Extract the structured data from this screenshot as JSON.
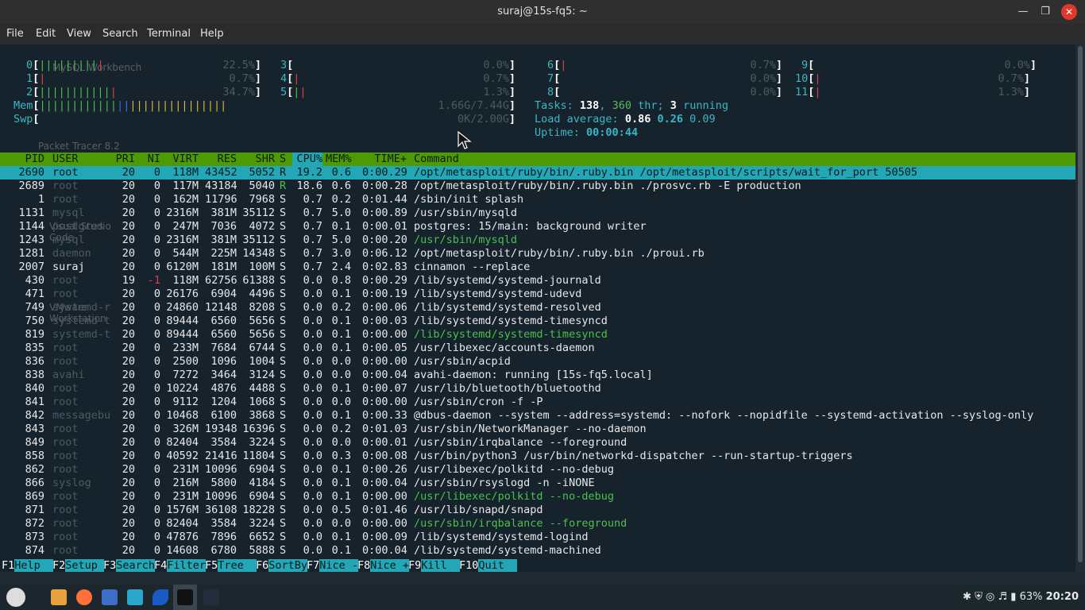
{
  "window": {
    "title": "suraj@15s-fq5: ~"
  },
  "menu": [
    "File",
    "Edit",
    "View",
    "Search",
    "Terminal",
    "Help"
  ],
  "desktop": {
    "icons": [
      "MySQL Workbench",
      "Packet Tracer 8.2",
      "Visual Studio Code",
      "VMware Workstation"
    ]
  },
  "meters": {
    "cpus": [
      {
        "id": "0",
        "pct": "22.5%"
      },
      {
        "id": "1",
        "pct": "0.7%"
      },
      {
        "id": "2",
        "pct": "34.7%"
      },
      {
        "id": "3",
        "pct": "0.0%"
      },
      {
        "id": "4",
        "pct": "0.7%"
      },
      {
        "id": "5",
        "pct": "1.3%"
      },
      {
        "id": "6",
        "pct": "0.7%"
      },
      {
        "id": "7",
        "pct": "0.0%"
      },
      {
        "id": "8",
        "pct": "0.0%"
      },
      {
        "id": "9",
        "pct": "0.0%"
      },
      {
        "id": "10",
        "pct": "0.7%"
      },
      {
        "id": "11",
        "pct": "1.3%"
      }
    ],
    "mem": {
      "label": "Mem",
      "value": "1.66G/7.44G"
    },
    "swp": {
      "label": "Swp",
      "value": "0K/2.00G"
    }
  },
  "summary": {
    "tasks_label": "Tasks:",
    "tasks": "138",
    "thr": "360",
    "thr_label": "thr;",
    "running": "3",
    "running_label": "running",
    "load_label": "Load average:",
    "load1": "0.86",
    "load5": "0.26",
    "load15": "0.09",
    "uptime_label": "Uptime:",
    "uptime": "00:00:44"
  },
  "columns": [
    "PID",
    "USER",
    "PRI",
    "NI",
    "VIRT",
    "RES",
    "SHR",
    "S",
    "CPU%",
    "MEM%",
    "TIME+",
    "Command"
  ],
  "processes": [
    {
      "pid": "2690",
      "user": "root",
      "pri": "20",
      "ni": "0",
      "virt": "118M",
      "res": "43452",
      "shr": "5052",
      "s": "R",
      "cpu": "19.2",
      "mem": "0.6",
      "time": "0:00.29",
      "cmd": "/opt/metasploit/ruby/bin/.ruby.bin /opt/metasploit/scripts/wait_for_port 50505"
    },
    {
      "pid": "2689",
      "user": "root",
      "pri": "20",
      "ni": "0",
      "virt": "117M",
      "res": "43184",
      "shr": "5040",
      "s": "R",
      "cpu": "18.6",
      "mem": "0.6",
      "time": "0:00.28",
      "cmd": "/opt/metasploit/ruby/bin/.ruby.bin ./prosvc.rb -E production"
    },
    {
      "pid": "1",
      "user": "root",
      "pri": "20",
      "ni": "0",
      "virt": "162M",
      "res": "11796",
      "shr": "7968",
      "s": "S",
      "cpu": "0.7",
      "mem": "0.2",
      "time": "0:01.44",
      "cmd": "/sbin/init splash"
    },
    {
      "pid": "1131",
      "user": "mysql",
      "pri": "20",
      "ni": "0",
      "virt": "2316M",
      "res": "381M",
      "shr": "35112",
      "s": "S",
      "cpu": "0.7",
      "mem": "5.0",
      "time": "0:00.89",
      "cmd": "/usr/sbin/mysqld"
    },
    {
      "pid": "1144",
      "user": "postgres",
      "pri": "20",
      "ni": "0",
      "virt": "247M",
      "res": "7036",
      "shr": "4072",
      "s": "S",
      "cpu": "0.7",
      "mem": "0.1",
      "time": "0:00.01",
      "cmd": "postgres: 15/main: background writer"
    },
    {
      "pid": "1243",
      "user": "mysql",
      "pri": "20",
      "ni": "0",
      "virt": "2316M",
      "res": "381M",
      "shr": "35112",
      "s": "S",
      "cpu": "0.7",
      "mem": "5.0",
      "time": "0:00.20",
      "cmd": "/usr/sbin/mysqld",
      "thread": true
    },
    {
      "pid": "1281",
      "user": "daemon",
      "pri": "20",
      "ni": "0",
      "virt": "544M",
      "res": "225M",
      "shr": "14348",
      "s": "S",
      "cpu": "0.7",
      "mem": "3.0",
      "time": "0:06.12",
      "cmd": "/opt/metasploit/ruby/bin/.ruby.bin ./proui.rb"
    },
    {
      "pid": "2007",
      "user": "suraj",
      "pri": "20",
      "ni": "0",
      "virt": "6120M",
      "res": "181M",
      "shr": "100M",
      "s": "S",
      "cpu": "0.7",
      "mem": "2.4",
      "time": "0:02.83",
      "cmd": "cinnamon --replace"
    },
    {
      "pid": "430",
      "user": "root",
      "pri": "19",
      "ni": "-1",
      "virt": "118M",
      "res": "62756",
      "shr": "61388",
      "s": "S",
      "cpu": "0.0",
      "mem": "0.8",
      "time": "0:00.29",
      "cmd": "/lib/systemd/systemd-journald"
    },
    {
      "pid": "471",
      "user": "root",
      "pri": "20",
      "ni": "0",
      "virt": "26176",
      "res": "6904",
      "shr": "4496",
      "s": "S",
      "cpu": "0.0",
      "mem": "0.1",
      "time": "0:00.19",
      "cmd": "/lib/systemd/systemd-udevd"
    },
    {
      "pid": "749",
      "user": "systemd-r",
      "pri": "20",
      "ni": "0",
      "virt": "24860",
      "res": "12148",
      "shr": "8208",
      "s": "S",
      "cpu": "0.0",
      "mem": "0.2",
      "time": "0:00.06",
      "cmd": "/lib/systemd/systemd-resolved"
    },
    {
      "pid": "750",
      "user": "systemd-t",
      "pri": "20",
      "ni": "0",
      "virt": "89444",
      "res": "6560",
      "shr": "5656",
      "s": "S",
      "cpu": "0.0",
      "mem": "0.1",
      "time": "0:00.03",
      "cmd": "/lib/systemd/systemd-timesyncd"
    },
    {
      "pid": "819",
      "user": "systemd-t",
      "pri": "20",
      "ni": "0",
      "virt": "89444",
      "res": "6560",
      "shr": "5656",
      "s": "S",
      "cpu": "0.0",
      "mem": "0.1",
      "time": "0:00.00",
      "cmd": "/lib/systemd/systemd-timesyncd",
      "thread": true
    },
    {
      "pid": "835",
      "user": "root",
      "pri": "20",
      "ni": "0",
      "virt": "233M",
      "res": "7684",
      "shr": "6744",
      "s": "S",
      "cpu": "0.0",
      "mem": "0.1",
      "time": "0:00.05",
      "cmd": "/usr/libexec/accounts-daemon"
    },
    {
      "pid": "836",
      "user": "root",
      "pri": "20",
      "ni": "0",
      "virt": "2500",
      "res": "1096",
      "shr": "1004",
      "s": "S",
      "cpu": "0.0",
      "mem": "0.0",
      "time": "0:00.00",
      "cmd": "/usr/sbin/acpid"
    },
    {
      "pid": "838",
      "user": "avahi",
      "pri": "20",
      "ni": "0",
      "virt": "7272",
      "res": "3464",
      "shr": "3124",
      "s": "S",
      "cpu": "0.0",
      "mem": "0.0",
      "time": "0:00.04",
      "cmd": "avahi-daemon: running [15s-fq5.local]"
    },
    {
      "pid": "840",
      "user": "root",
      "pri": "20",
      "ni": "0",
      "virt": "10224",
      "res": "4876",
      "shr": "4488",
      "s": "S",
      "cpu": "0.0",
      "mem": "0.1",
      "time": "0:00.07",
      "cmd": "/usr/lib/bluetooth/bluetoothd"
    },
    {
      "pid": "841",
      "user": "root",
      "pri": "20",
      "ni": "0",
      "virt": "9112",
      "res": "1204",
      "shr": "1068",
      "s": "S",
      "cpu": "0.0",
      "mem": "0.0",
      "time": "0:00.00",
      "cmd": "/usr/sbin/cron -f -P"
    },
    {
      "pid": "842",
      "user": "messagebu",
      "pri": "20",
      "ni": "0",
      "virt": "10468",
      "res": "6100",
      "shr": "3868",
      "s": "S",
      "cpu": "0.0",
      "mem": "0.1",
      "time": "0:00.33",
      "cmd": "@dbus-daemon --system --address=systemd: --nofork --nopidfile --systemd-activation --syslog-only"
    },
    {
      "pid": "843",
      "user": "root",
      "pri": "20",
      "ni": "0",
      "virt": "326M",
      "res": "19348",
      "shr": "16396",
      "s": "S",
      "cpu": "0.0",
      "mem": "0.2",
      "time": "0:01.03",
      "cmd": "/usr/sbin/NetworkManager --no-daemon"
    },
    {
      "pid": "849",
      "user": "root",
      "pri": "20",
      "ni": "0",
      "virt": "82404",
      "res": "3584",
      "shr": "3224",
      "s": "S",
      "cpu": "0.0",
      "mem": "0.0",
      "time": "0:00.01",
      "cmd": "/usr/sbin/irqbalance --foreground"
    },
    {
      "pid": "858",
      "user": "root",
      "pri": "20",
      "ni": "0",
      "virt": "40592",
      "res": "21416",
      "shr": "11804",
      "s": "S",
      "cpu": "0.0",
      "mem": "0.3",
      "time": "0:00.08",
      "cmd": "/usr/bin/python3 /usr/bin/networkd-dispatcher --run-startup-triggers"
    },
    {
      "pid": "862",
      "user": "root",
      "pri": "20",
      "ni": "0",
      "virt": "231M",
      "res": "10096",
      "shr": "6904",
      "s": "S",
      "cpu": "0.0",
      "mem": "0.1",
      "time": "0:00.26",
      "cmd": "/usr/libexec/polkitd --no-debug"
    },
    {
      "pid": "866",
      "user": "syslog",
      "pri": "20",
      "ni": "0",
      "virt": "216M",
      "res": "5800",
      "shr": "4184",
      "s": "S",
      "cpu": "0.0",
      "mem": "0.1",
      "time": "0:00.04",
      "cmd": "/usr/sbin/rsyslogd -n -iNONE"
    },
    {
      "pid": "869",
      "user": "root",
      "pri": "20",
      "ni": "0",
      "virt": "231M",
      "res": "10096",
      "shr": "6904",
      "s": "S",
      "cpu": "0.0",
      "mem": "0.1",
      "time": "0:00.00",
      "cmd": "/usr/libexec/polkitd --no-debug",
      "thread": true
    },
    {
      "pid": "871",
      "user": "root",
      "pri": "20",
      "ni": "0",
      "virt": "1576M",
      "res": "36108",
      "shr": "18228",
      "s": "S",
      "cpu": "0.0",
      "mem": "0.5",
      "time": "0:01.46",
      "cmd": "/usr/lib/snapd/snapd"
    },
    {
      "pid": "872",
      "user": "root",
      "pri": "20",
      "ni": "0",
      "virt": "82404",
      "res": "3584",
      "shr": "3224",
      "s": "S",
      "cpu": "0.0",
      "mem": "0.0",
      "time": "0:00.00",
      "cmd": "/usr/sbin/irqbalance --foreground",
      "thread": true
    },
    {
      "pid": "873",
      "user": "root",
      "pri": "20",
      "ni": "0",
      "virt": "47876",
      "res": "7896",
      "shr": "6652",
      "s": "S",
      "cpu": "0.0",
      "mem": "0.1",
      "time": "0:00.09",
      "cmd": "/lib/systemd/systemd-logind"
    },
    {
      "pid": "874",
      "user": "root",
      "pri": "20",
      "ni": "0",
      "virt": "14608",
      "res": "6780",
      "shr": "5888",
      "s": "S",
      "cpu": "0.0",
      "mem": "0.1",
      "time": "0:00.04",
      "cmd": "/lib/systemd/systemd-machined"
    }
  ],
  "fkeys": [
    {
      "key": "F1",
      "label": "Help  "
    },
    {
      "key": "F2",
      "label": "Setup "
    },
    {
      "key": "F3",
      "label": "Search"
    },
    {
      "key": "F4",
      "label": "Filter"
    },
    {
      "key": "F5",
      "label": "Tree  "
    },
    {
      "key": "F6",
      "label": "SortBy"
    },
    {
      "key": "F7",
      "label": "Nice -"
    },
    {
      "key": "F8",
      "label": "Nice +"
    },
    {
      "key": "F9",
      "label": "Kill  "
    },
    {
      "key": "F10",
      "label": "Quit  "
    }
  ],
  "tray": {
    "battery": "63%",
    "time": "20:20"
  },
  "colors": {
    "header_bg": "#4e9a06",
    "selected_bg": "#23a6b5",
    "close": "#e0392b"
  },
  "icons": [
    "minimize-icon",
    "maximize-icon",
    "close-icon",
    "menu-icon",
    "files-icon",
    "firefox-icon",
    "mail-icon",
    "zap-icon",
    "wireshark-icon",
    "terminal-icon",
    "powershell-icon",
    "bluetooth-icon",
    "shield-icon",
    "wifi-icon",
    "volume-icon",
    "battery-icon"
  ]
}
